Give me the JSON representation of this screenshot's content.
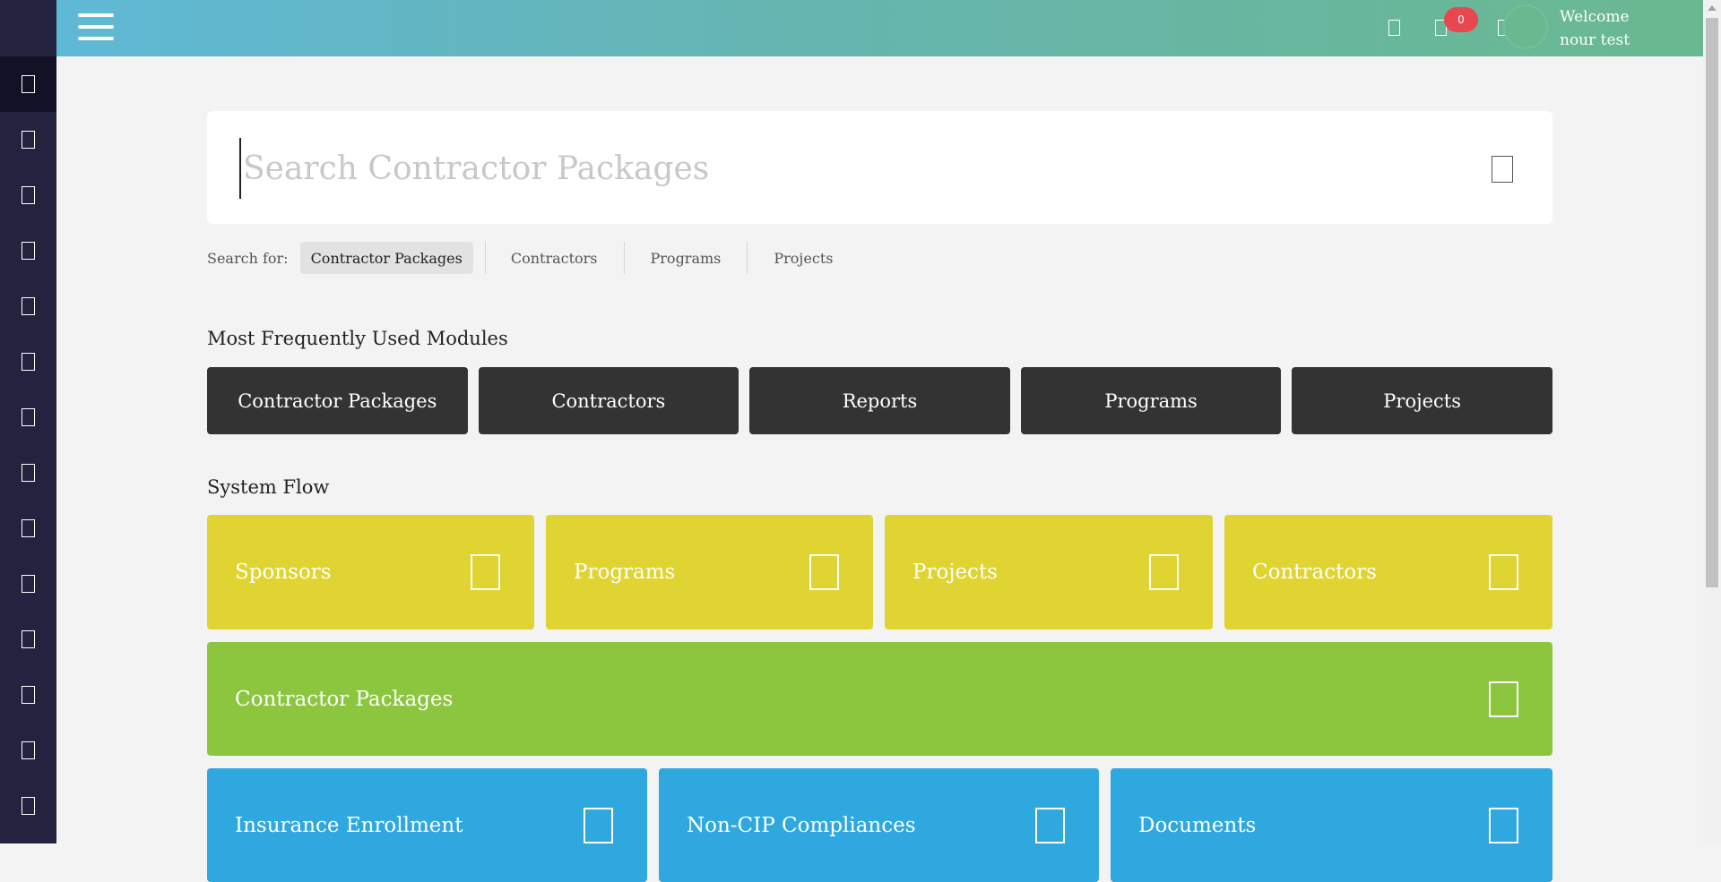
{
  "sidebar": {
    "items": [
      {
        "icon": "dashboard-icon",
        "active": true
      },
      {
        "icon": "sponsors-icon"
      },
      {
        "icon": "programs-icon"
      },
      {
        "icon": "projects-icon"
      },
      {
        "icon": "contractors-icon"
      },
      {
        "icon": "contractor-packages-icon"
      },
      {
        "icon": "insurance-icon"
      },
      {
        "icon": "compliance-icon"
      },
      {
        "icon": "documents-icon"
      },
      {
        "icon": "reports-icon"
      },
      {
        "icon": "users-icon"
      },
      {
        "icon": "settings-icon"
      },
      {
        "icon": "help-icon"
      },
      {
        "icon": "logout-icon"
      }
    ]
  },
  "topbar": {
    "menu_icon": "hamburger-menu-icon",
    "icons": [
      "bell-icon",
      "message-icon",
      "envelope-icon"
    ],
    "badges": {
      "messages": "0",
      "notifications": "0"
    },
    "welcome_line1": "Welcome",
    "welcome_line2": "nour test",
    "colors": {
      "gradient_start": "#5fb8d6",
      "gradient_end": "#6ab890",
      "badge_red": "#e8474f",
      "badge_blue": "#4aa3e8"
    }
  },
  "search": {
    "placeholder": "Search Contractor Packages",
    "value": "",
    "icon": "search-icon",
    "label": "Search for:",
    "options": [
      "Contractor Packages",
      "Contractors",
      "Programs",
      "Projects"
    ],
    "selected": "Contractor Packages"
  },
  "modules": {
    "title": "Most Frequently Used Modules",
    "items": [
      "Contractor Packages",
      "Contractors",
      "Reports",
      "Programs",
      "Projects"
    ],
    "color": "#333333"
  },
  "flow": {
    "title": "System Flow",
    "row1": [
      "Sponsors",
      "Programs",
      "Projects",
      "Contractors"
    ],
    "row2": [
      "Contractor Packages"
    ],
    "row3": [
      "Insurance Enrollment",
      "Non-CIP Compliances",
      "Documents"
    ],
    "colors": {
      "row1": "#e0d432",
      "row2": "#8cc63f",
      "row3": "#2fa8e0"
    }
  }
}
